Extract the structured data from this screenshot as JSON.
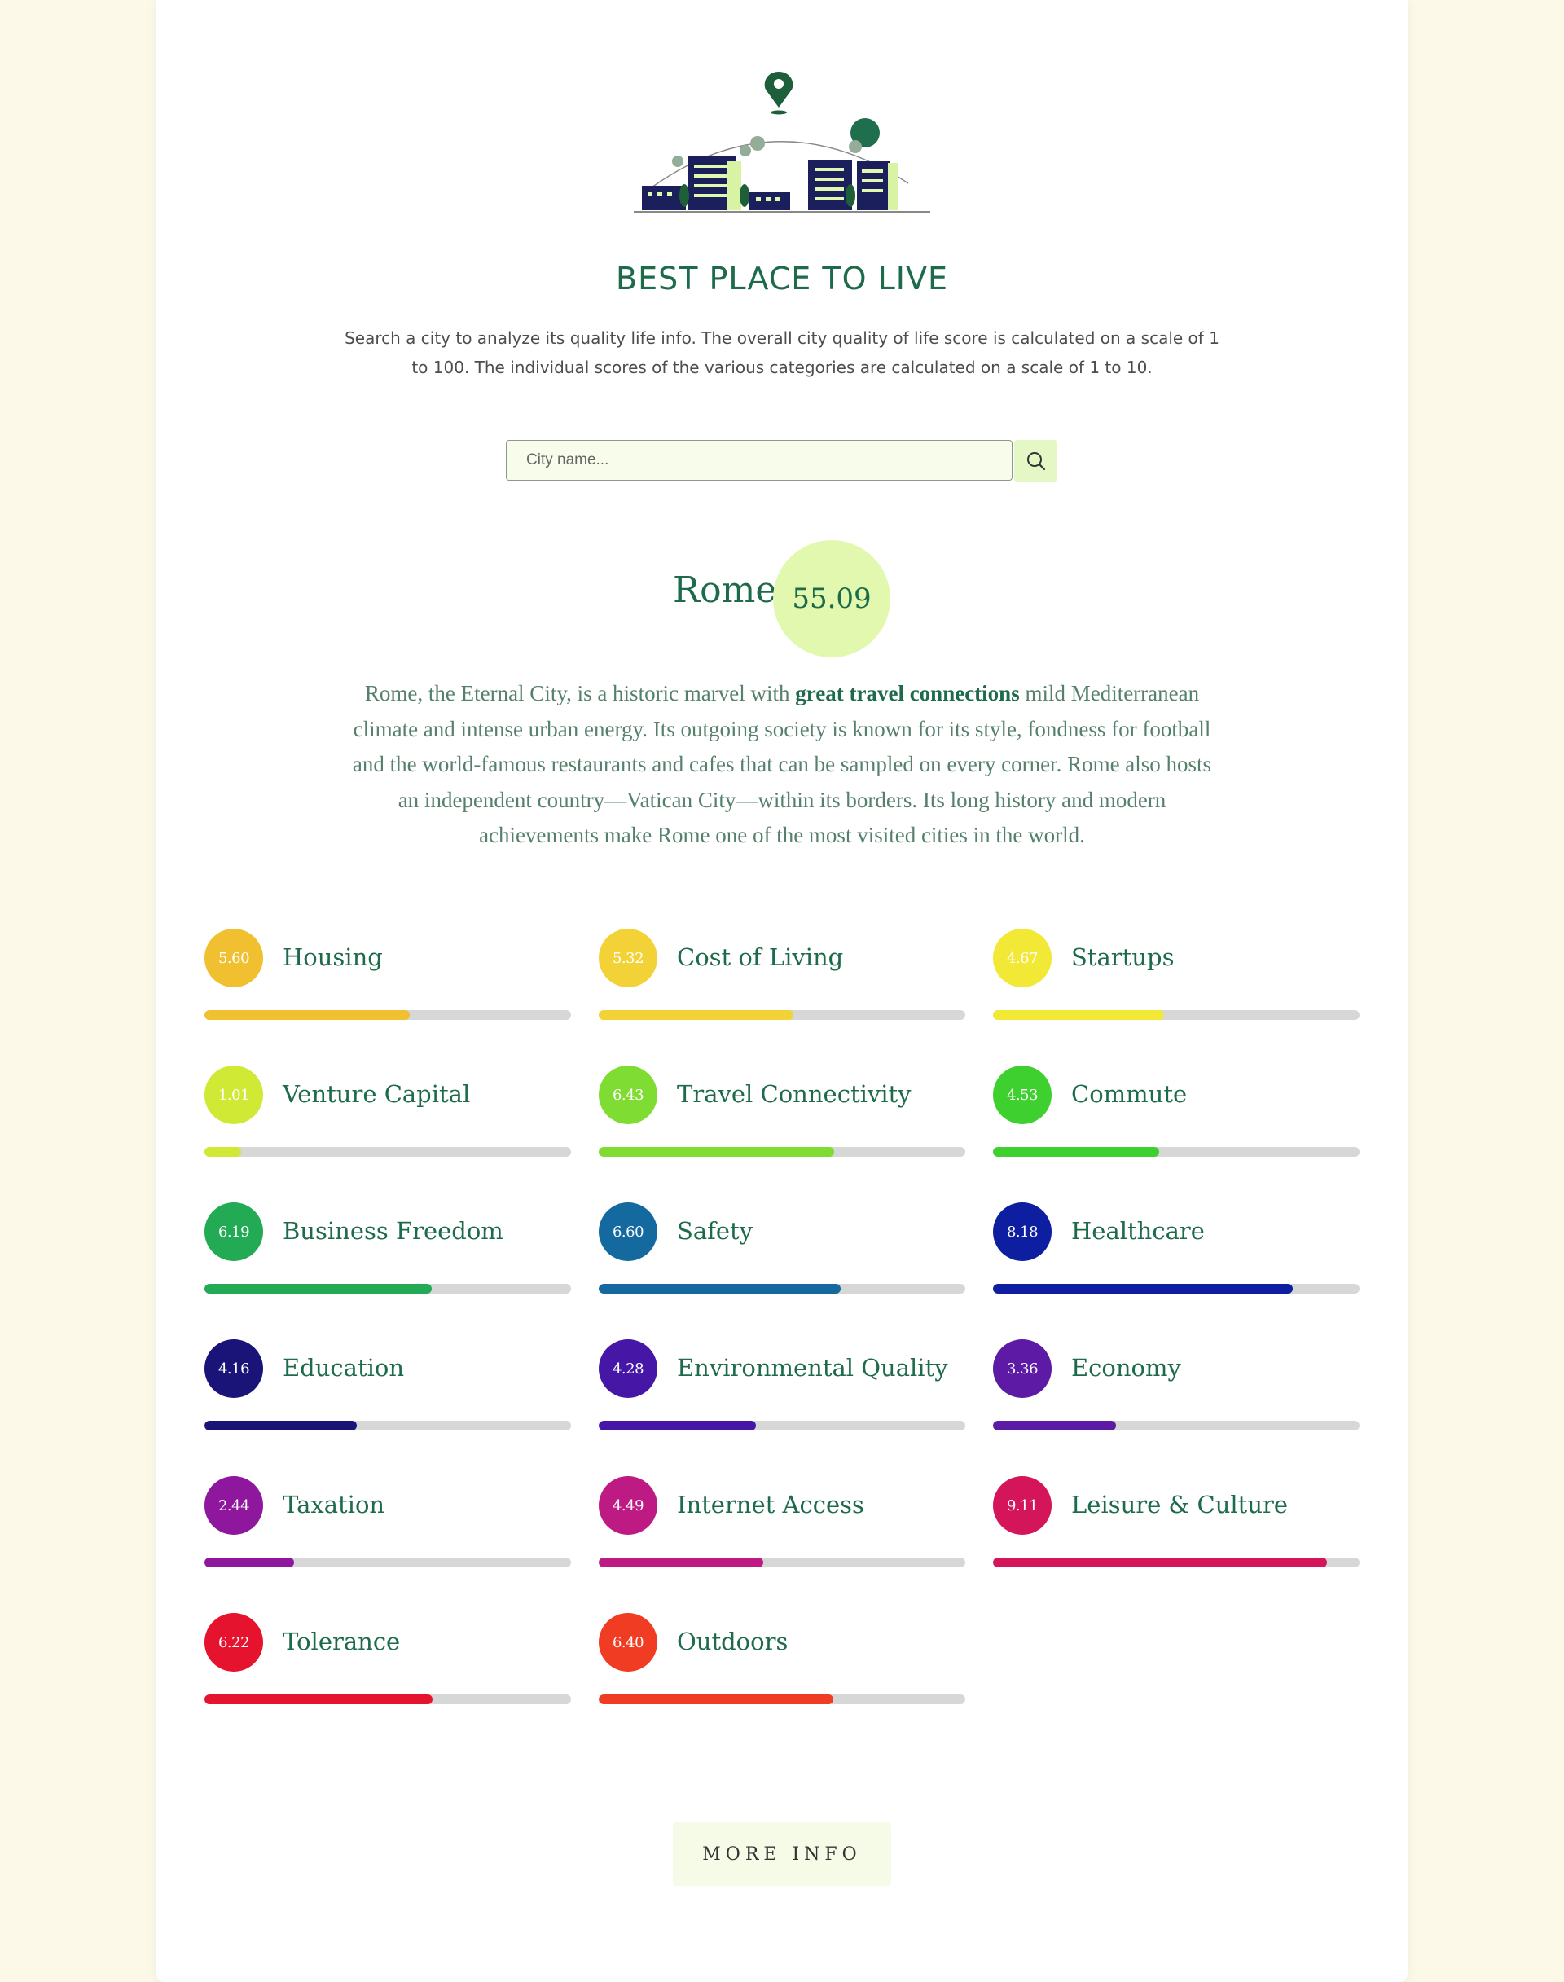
{
  "header": {
    "title": "BEST PLACE TO LIVE",
    "description": "Search a city to analyze its quality life info. The overall city quality of life score is calculated on a scale of 1 to 100. The individual scores of the various categories are calculated on a scale of 1 to 10."
  },
  "search": {
    "placeholder": "City name...",
    "value": "",
    "button_icon": "search-icon"
  },
  "city": {
    "name": "Rome",
    "score": "55.09",
    "summary_before": "Rome, the Eternal City, is a historic marvel with ",
    "summary_highlight": "great travel connections",
    "summary_after": " mild Mediterranean climate and intense urban energy. Its outgoing society is known for its style, fondness for football and the world-famous restaurants and cafes that can be sampled on every corner. Rome also hosts an independent country—Vatican City—within its borders. Its long history and modern achievements make Rome one of the most visited cities in the world."
  },
  "categories": [
    {
      "name": "Housing",
      "score": "5.60",
      "fraction": 0.56,
      "color": "#f0c030"
    },
    {
      "name": "Cost of Living",
      "score": "5.32",
      "fraction": 0.532,
      "color": "#f2d236"
    },
    {
      "name": "Startups",
      "score": "4.67",
      "fraction": 0.467,
      "color": "#f2e836"
    },
    {
      "name": "Venture Capital",
      "score": "1.01",
      "fraction": 0.101,
      "color": "#cfe935"
    },
    {
      "name": "Travel Connectivity",
      "score": "6.43",
      "fraction": 0.643,
      "color": "#7fdc32"
    },
    {
      "name": "Commute",
      "score": "4.53",
      "fraction": 0.453,
      "color": "#3ed02e"
    },
    {
      "name": "Business Freedom",
      "score": "6.19",
      "fraction": 0.619,
      "color": "#22aa55"
    },
    {
      "name": "Safety",
      "score": "6.60",
      "fraction": 0.66,
      "color": "#146a9e"
    },
    {
      "name": "Healthcare",
      "score": "8.18",
      "fraction": 0.818,
      "color": "#0d1fa0"
    },
    {
      "name": "Education",
      "score": "4.16",
      "fraction": 0.416,
      "color": "#1b1478"
    },
    {
      "name": "Environmental Quality",
      "score": "4.28",
      "fraction": 0.428,
      "color": "#4617a6"
    },
    {
      "name": "Economy",
      "score": "3.36",
      "fraction": 0.336,
      "color": "#5d1aa4"
    },
    {
      "name": "Taxation",
      "score": "2.44",
      "fraction": 0.244,
      "color": "#8e179e"
    },
    {
      "name": "Internet Access",
      "score": "4.49",
      "fraction": 0.449,
      "color": "#bd1a84"
    },
    {
      "name": "Leisure & Culture",
      "score": "9.11",
      "fraction": 0.911,
      "color": "#d4155a"
    },
    {
      "name": "Tolerance",
      "score": "6.22",
      "fraction": 0.622,
      "color": "#e5132e"
    },
    {
      "name": "Outdoors",
      "score": "6.40",
      "fraction": 0.64,
      "color": "#ef3c22"
    }
  ],
  "more_info_label": "MORE INFO"
}
